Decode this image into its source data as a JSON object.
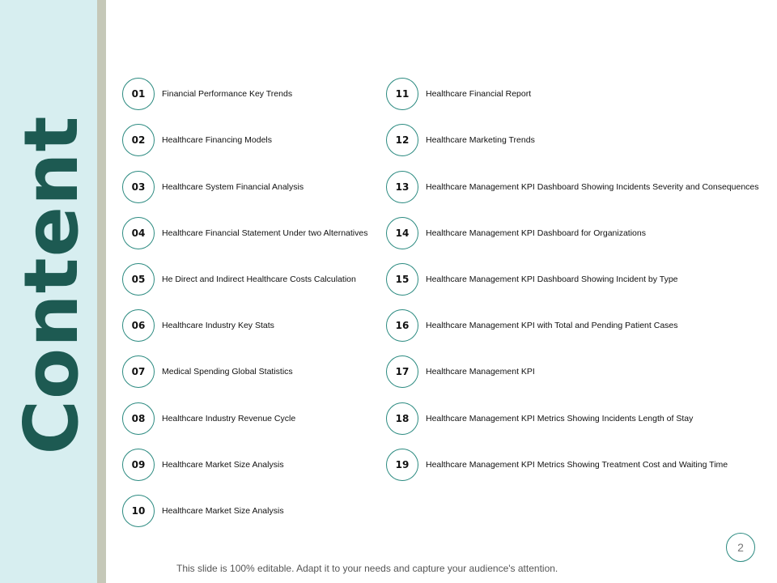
{
  "slide": {
    "title": "Content",
    "page_number": "2",
    "footer": "This slide is 100% editable. Adapt it to your needs and capture your audience's attention."
  },
  "items": [
    {
      "num": "01",
      "label": "Financial Performance Key Trends"
    },
    {
      "num": "02",
      "label": "Healthcare Financing Models"
    },
    {
      "num": "03",
      "label": "Healthcare System Financial Analysis"
    },
    {
      "num": "04",
      "label": "Healthcare Financial Statement Under two Alternatives"
    },
    {
      "num": "05",
      "label": "He Direct and Indirect Healthcare Costs Calculation"
    },
    {
      "num": "06",
      "label": "Healthcare Industry Key Stats"
    },
    {
      "num": "07",
      "label": "Medical Spending Global Statistics"
    },
    {
      "num": "08",
      "label": "Healthcare Industry Revenue Cycle"
    },
    {
      "num": "09",
      "label": "Healthcare Market Size Analysis"
    },
    {
      "num": "10",
      "label": "Healthcare Market Size Analysis"
    },
    {
      "num": "11",
      "label": "Healthcare Financial Report"
    },
    {
      "num": "12",
      "label": "Healthcare Marketing Trends"
    },
    {
      "num": "13",
      "label": "Healthcare Management KPI Dashboard Showing Incidents Severity and Consequences"
    },
    {
      "num": "14",
      "label": "Healthcare Management KPI Dashboard for Organizations"
    },
    {
      "num": "15",
      "label": "Healthcare Management KPI Dashboard Showing Incident by Type"
    },
    {
      "num": "16",
      "label": "Healthcare Management KPI with Total and Pending Patient Cases"
    },
    {
      "num": "17",
      "label": "Healthcare Management KPI"
    },
    {
      "num": "18",
      "label": "Healthcare Management KPI Metrics Showing Incidents Length of Stay"
    },
    {
      "num": "19",
      "label": "Healthcare Management KPI Metrics Showing Treatment Cost and Waiting Time"
    }
  ]
}
